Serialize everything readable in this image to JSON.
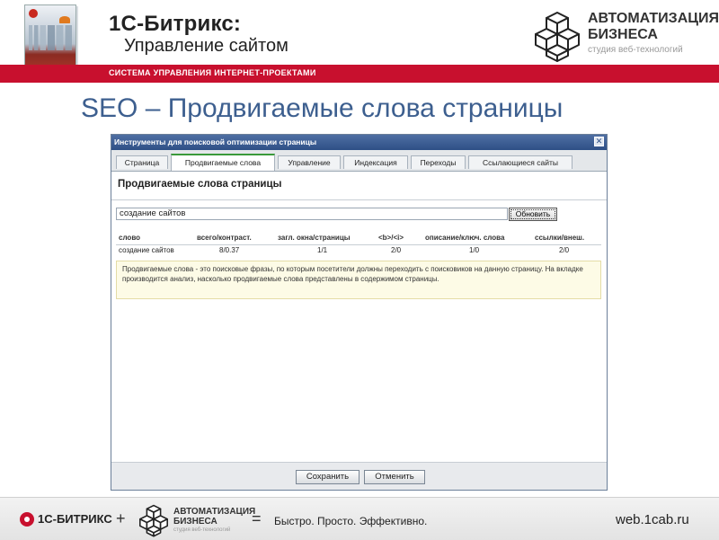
{
  "header": {
    "brand_title": "1С-Битрикс:",
    "brand_subtitle": "Управление сайтом",
    "partner_title_line1": "АВТОМАТИЗАЦИЯ",
    "partner_title_line2": "БИЗНЕСА",
    "partner_subtitle": "студия веб-технологий",
    "redbar_text": "СИСТЕМА УПРАВЛЕНИЯ ИНТЕРНЕТ-ПРОЕКТАМИ",
    "accent_color": "#c8102e"
  },
  "slide_title": "SEO – Продвигаемые слова страницы",
  "dialog": {
    "title": "Инструменты для поисковой оптимизации страницы",
    "close_label": "✕",
    "tabs": [
      {
        "label": "Страница"
      },
      {
        "label": "Продвигаемые слова",
        "active": true
      },
      {
        "label": "Управление"
      },
      {
        "label": "Индексация"
      },
      {
        "label": "Переходы"
      },
      {
        "label": "Ссылающиеся сайты"
      }
    ],
    "content_title": "Продвигаемые слова страницы",
    "keyword_input_value": "создание сайтов",
    "update_button": "Обновить",
    "table": {
      "headers": [
        "слово",
        "всего/контраст.",
        "загл. окна/страницы",
        "<b>/<i>",
        "описание/ключ. слова",
        "ссылки/внеш."
      ],
      "rows": [
        [
          "создание сайтов",
          "8/0.37",
          "1/1",
          "2/0",
          "1/0",
          "2/0"
        ]
      ]
    },
    "info_text": "Продвигаемые слова - это поисковые фразы, по которым посетители должны переходить с поисковиков на данную страницу. На вкладке производится анализ, насколько продвигаемые слова представлены в содержимом страницы.",
    "save_button": "Сохранить",
    "cancel_button": "Отменить"
  },
  "footer_banner": {
    "brand": "1С-БИТРИКС",
    "plus": "+",
    "partner_line1": "АВТОМАТИЗАЦИЯ",
    "partner_line2": "БИЗНЕСА",
    "partner_sub": "студия веб-технологий",
    "equals": "=",
    "slogan": "Быстро. Просто. Эффективно.",
    "url": "web.1cab.ru"
  }
}
